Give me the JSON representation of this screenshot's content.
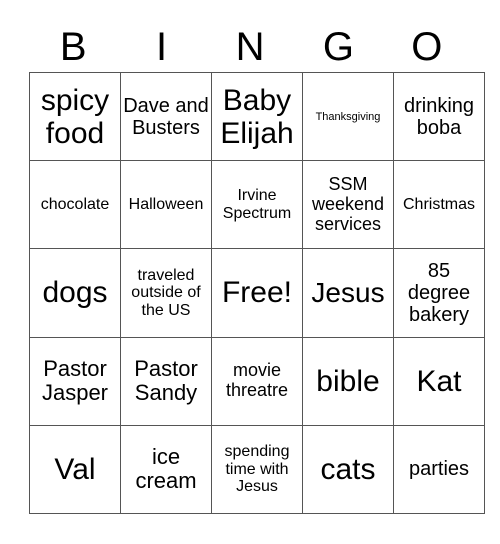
{
  "header": [
    "B",
    "I",
    "N",
    "G",
    "O"
  ],
  "rows": [
    [
      "spicy food",
      "Dave and Busters",
      "Baby Elijah",
      "Thanksgiving",
      "drinking boba"
    ],
    [
      "chocolate",
      "Halloween",
      "Irvine Spectrum",
      "SSM weekend services",
      "Christmas"
    ],
    [
      "dogs",
      "traveled outside of the US",
      "Free!",
      "Jesus",
      "85 degree bakery"
    ],
    [
      "Pastor Jasper",
      "Pastor Sandy",
      "movie threatre",
      "bible",
      "Kat"
    ],
    [
      "Val",
      "ice cream",
      "spending time with Jesus",
      "cats",
      "parties"
    ]
  ]
}
